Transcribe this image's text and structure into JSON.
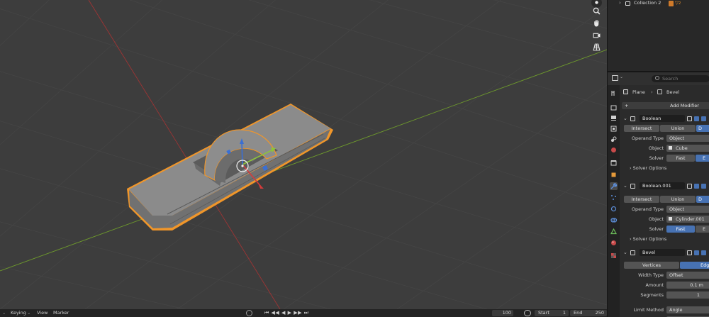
{
  "outliner": {
    "collection_label": "Collection 2",
    "collection_badge": "2"
  },
  "properties": {
    "search_placeholder": "Search",
    "breadcrumb": {
      "object": "Plane",
      "modifier": "Bevel"
    },
    "add_modifier_label": "Add Modifier",
    "modifiers": [
      {
        "name": "Boolean",
        "operations": [
          "Intersect",
          "Union",
          "D"
        ],
        "selected_operation": "D",
        "operand_type_label": "Operand Type",
        "operand_type_value": "Object",
        "object_label": "Object",
        "object_value": "Cube",
        "solver_label": "Solver",
        "solver_options": [
          "Fast",
          "E"
        ],
        "selected_solver": "E",
        "solver_options_label": "Solver Options"
      },
      {
        "name": "Boolean.001",
        "operations": [
          "Intersect",
          "Union",
          "D"
        ],
        "selected_operation": "D",
        "operand_type_label": "Operand Type",
        "operand_type_value": "Object",
        "object_label": "Object",
        "object_value": "Cylinder.001",
        "solver_label": "Solver",
        "solver_options": [
          "Fast",
          "E"
        ],
        "selected_solver": "Fast",
        "solver_options_label": "Solver Options"
      },
      {
        "name": "Bevel",
        "affect_options": [
          "Vertices",
          "Edg"
        ],
        "selected_affect": "Edg",
        "width_type_label": "Width Type",
        "width_type_value": "Offset",
        "amount_label": "Amount",
        "amount_value": "0.1 m",
        "segments_label": "Segments",
        "segments_value": "1",
        "limit_method_label": "Limit Method",
        "limit_method_value": "Angle"
      }
    ]
  },
  "timeline": {
    "keying_label": "Keying",
    "view_label": "View",
    "marker_label": "Marker",
    "current_frame": "100",
    "start_label": "Start",
    "start_value": "1",
    "end_label": "End",
    "end_value": "250"
  },
  "colors": {
    "viewport_bg": "#3c3c3c",
    "selection_outline": "#f0962a",
    "x_axis": "#b03a3a",
    "y_axis": "#6e9a2c",
    "accent_blue": "#4772b3"
  }
}
